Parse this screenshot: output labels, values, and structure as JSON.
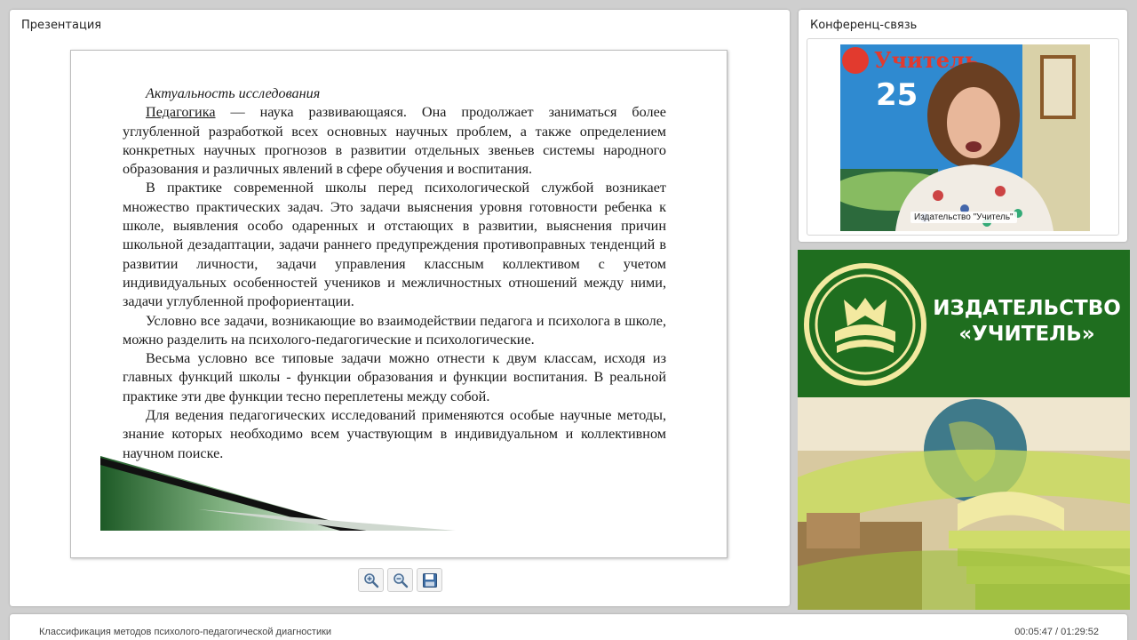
{
  "presentation": {
    "title": "Презентация",
    "slide": {
      "heading": "Актуальность исследования",
      "para1_term": "Педагогика",
      "para1_rest": " — наука развивающаяся. Она продолжает заниматься более углубленной разработкой всех основных научных проблем, а также определением конкретных научных прогнозов в развитии отдельных звеньев системы народного образования и различных явлений в сфере обучения и воспитания.",
      "para2": "В практике современной школы перед психологической службой возникает множество практических задач. Это задачи выяснения уровня готовности ребенка к школе, выявления особо одаренных и отстающих в развитии, выяснения причин школьной дезадаптации, задачи раннего предупреждения противоправных тенденций в развитии личности, задачи управления классным коллективом с учетом индивидуальных особенностей учеников и межличностных отношений между ними, задачи углубленной профориентации.",
      "para3": "Условно все задачи, возникающие во взаимодействии педагога и психолога в школе, можно разделить на психолого-педагогические и психологические.",
      "para4": "Весьма условно все типовые задачи можно отнести к двум классам, исходя из главных функций школы - функции образования и функции воспитания. В реальной практике эти две функции тесно переплетены между собой.",
      "para5": "Для ведения педагогических исследований применяются особые научные методы, знание которых необходимо всем участвующим в индивидуальном и коллективном научном поиске."
    },
    "toolbar": {
      "zoom_in_icon": "zoom-in-icon",
      "zoom_out_icon": "zoom-out-icon",
      "save_icon": "floppy-disk-icon"
    }
  },
  "conference": {
    "title": "Конференц-связь",
    "participant_label": "Издательство \"Учитель\"",
    "video_backdrop_text": "Учитель",
    "video_backdrop_number": "25"
  },
  "banner": {
    "line1": "ИЗДАТЕЛЬСТВО",
    "line2": "«УЧИТЕЛЬ»",
    "brand_color": "#1f6e1f"
  },
  "bottom": {
    "lesson_title": "Классификация методов психолого-педагогической диагностики",
    "time": "00:05:47 / 01:29:52"
  }
}
